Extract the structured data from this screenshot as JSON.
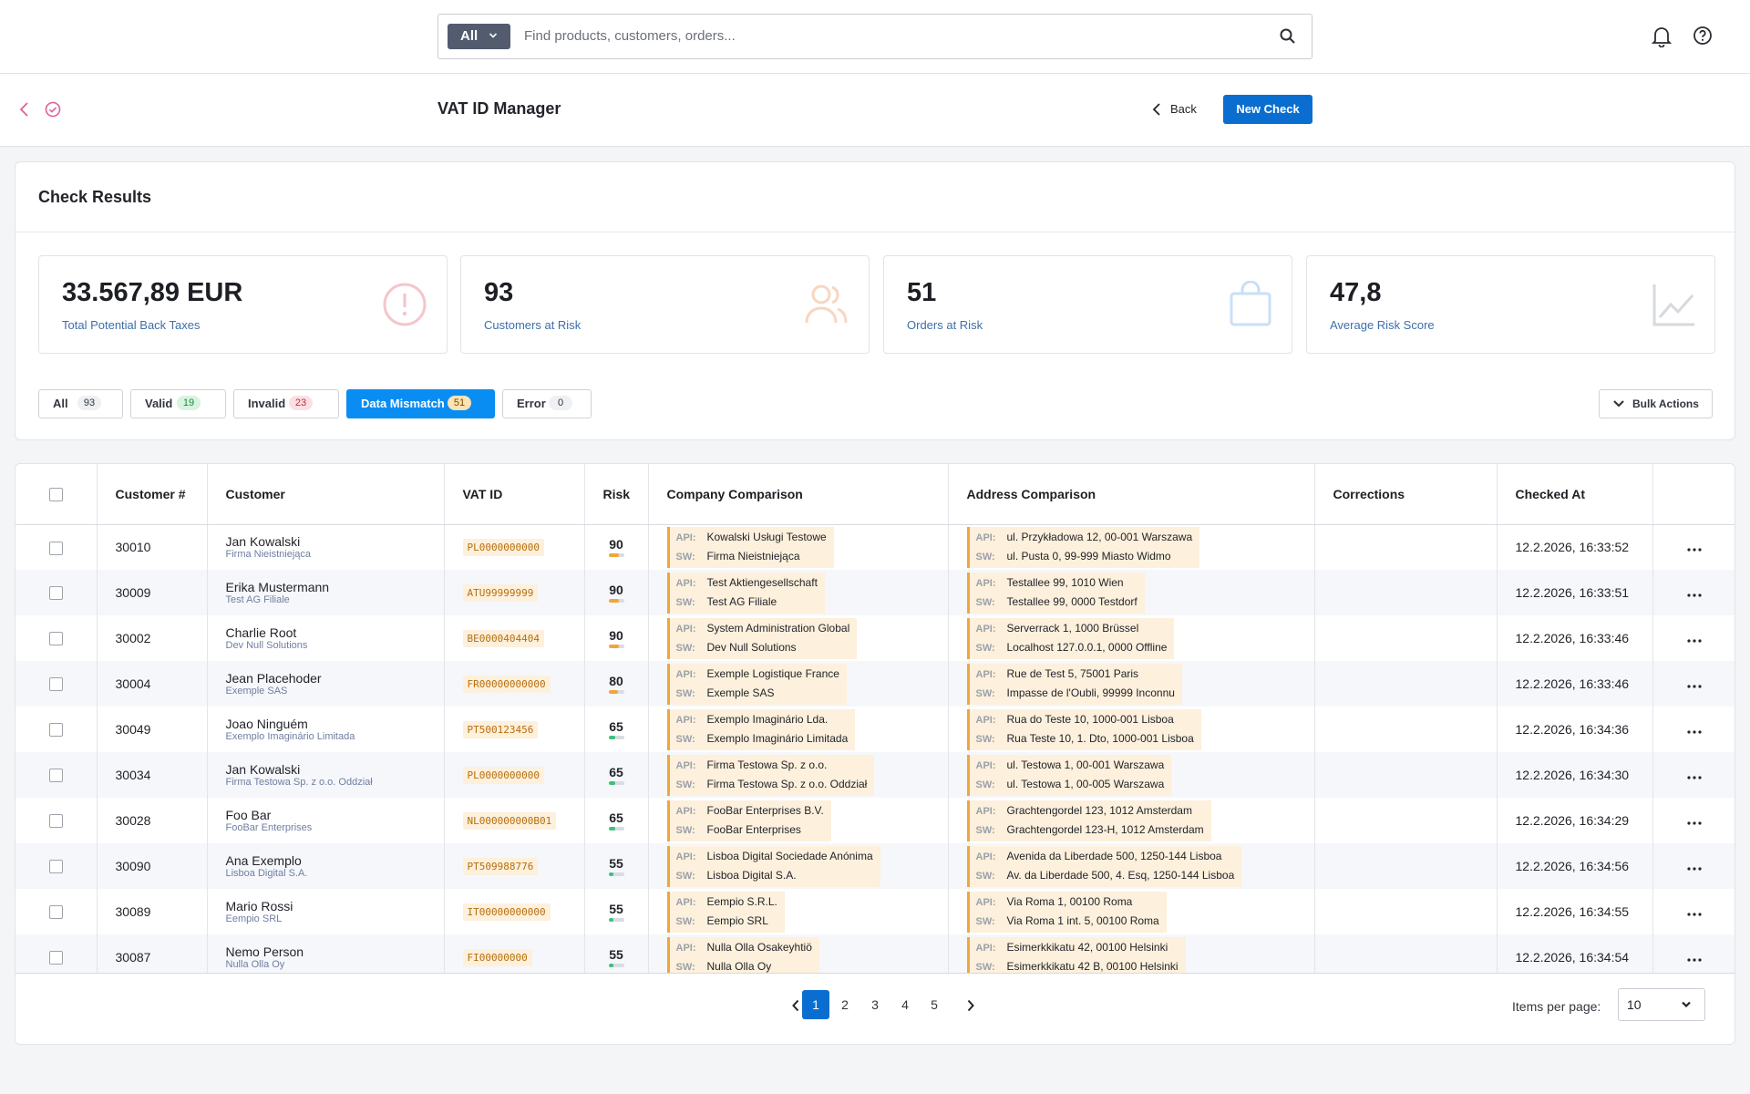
{
  "search": {
    "scope": "All",
    "placeholder": "Find products, customers, orders..."
  },
  "header": {
    "title": "VAT ID Manager",
    "back_label": "Back",
    "new_label": "New Check"
  },
  "card": {
    "title": "Check Results"
  },
  "kpis": [
    {
      "value": "33.567,89 EUR",
      "label": "Total Potential Back Taxes",
      "icon": "alert-circle-icon",
      "color": "#f3c6cc"
    },
    {
      "value": "93",
      "label": "Customers at Risk",
      "icon": "users-icon",
      "color": "#f7d6c2"
    },
    {
      "value": "51",
      "label": "Orders at Risk",
      "icon": "shopping-bag-icon",
      "color": "#c8dff6"
    },
    {
      "value": "47,8",
      "label": "Average Risk Score",
      "icon": "chart-line-icon",
      "color": "#d6d9de"
    }
  ],
  "filters": [
    {
      "label": "All",
      "count": "93",
      "active": false
    },
    {
      "label": "Valid",
      "count": "19",
      "active": false
    },
    {
      "label": "Invalid",
      "count": "23",
      "active": false
    },
    {
      "label": "Data Mismatch",
      "count": "51",
      "active": true
    },
    {
      "label": "Error",
      "count": "0",
      "active": false
    }
  ],
  "bulk_label": "Bulk Actions",
  "columns": [
    "Customer #",
    "Customer",
    "VAT ID",
    "Risk",
    "Company Comparison",
    "Address Comparison",
    "Corrections",
    "Checked At"
  ],
  "rows": [
    {
      "num": "30010",
      "name": "Jan Kowalski",
      "sub": "Firma Nieistniejąca",
      "vat": "PL0000000000",
      "risk": "90",
      "risk_pct": 0.7,
      "risk_color": "#f0a63b",
      "api_co": "Kowalski Usługi Testowe",
      "sw_co": "Firma Nieistniejąca",
      "api_addr": "ul. Przykładowa 12, 00-001 Warszawa",
      "sw_addr": "ul. Pusta 0, 99-999 Miasto Widmo",
      "corrections": "",
      "checked": "12.2.2026, 16:33:52"
    },
    {
      "num": "30009",
      "name": "Erika Mustermann",
      "sub": "Test AG Filiale",
      "vat": "ATU99999999",
      "risk": "90",
      "risk_pct": 0.7,
      "risk_color": "#f0a63b",
      "api_co": "Test Aktiengesellschaft",
      "sw_co": "Test AG Filiale",
      "api_addr": "Testallee 99, 1010 Wien",
      "sw_addr": "Testallee 99, 0000 Testdorf",
      "corrections": "",
      "checked": "12.2.2026, 16:33:51"
    },
    {
      "num": "30002",
      "name": "Charlie Root",
      "sub": "Dev Null Solutions",
      "vat": "BE0000404404",
      "risk": "90",
      "risk_pct": 0.7,
      "risk_color": "#f0a63b",
      "api_co": "System Administration Global",
      "sw_co": "Dev Null Solutions",
      "api_addr": "Serverrack 1, 1000 Brüssel",
      "sw_addr": "Localhost 127.0.0.1, 0000 Offline",
      "corrections": "",
      "checked": "12.2.2026, 16:33:46"
    },
    {
      "num": "30004",
      "name": "Jean Placehoder",
      "sub": "Exemple SAS",
      "vat": "FR00000000000",
      "risk": "80",
      "risk_pct": 0.6,
      "risk_color": "#f0a63b",
      "api_co": "Exemple Logistique France",
      "sw_co": "Exemple SAS",
      "api_addr": "Rue de Test 5, 75001 Paris",
      "sw_addr": "Impasse de l'Oubli, 99999 Inconnu",
      "corrections": "",
      "checked": "12.2.2026, 16:33:46"
    },
    {
      "num": "30049",
      "name": "Joao Ninguém",
      "sub": "Exemplo Imaginário Limitada",
      "vat": "PT500123456",
      "risk": "65",
      "risk_pct": 0.45,
      "risk_color": "#3cc17a",
      "api_co": "Exemplo Imaginário Lda.",
      "sw_co": "Exemplo Imaginário Limitada",
      "api_addr": "Rua do Teste 10, 1000-001 Lisboa",
      "sw_addr": "Rua Teste 10, 1. Dto, 1000-001 Lisboa",
      "corrections": "",
      "checked": "12.2.2026, 16:34:36"
    },
    {
      "num": "30034",
      "name": "Jan Kowalski",
      "sub": "Firma Testowa Sp. z o.o. Oddział",
      "vat": "PL0000000000",
      "risk": "65",
      "risk_pct": 0.45,
      "risk_color": "#3cc17a",
      "api_co": "Firma Testowa Sp. z o.o.",
      "sw_co": "Firma Testowa Sp. z o.o. Oddział",
      "api_addr": "ul. Testowa 1, 00-001 Warszawa",
      "sw_addr": "ul. Testowa 1, 00-005 Warszawa",
      "corrections": "",
      "checked": "12.2.2026, 16:34:30"
    },
    {
      "num": "30028",
      "name": "Foo Bar",
      "sub": "FooBar Enterprises",
      "vat": "NL000000000B01",
      "risk": "65",
      "risk_pct": 0.45,
      "risk_color": "#3cc17a",
      "api_co": "FooBar Enterprises B.V.",
      "sw_co": "FooBar Enterprises",
      "api_addr": "Grachtengordel 123, 1012 Amsterdam",
      "sw_addr": "Grachtengordel 123-H, 1012 Amsterdam",
      "corrections": "",
      "checked": "12.2.2026, 16:34:29"
    },
    {
      "num": "30090",
      "name": "Ana Exemplo",
      "sub": "Lisboa Digital S.A.",
      "vat": "PT509988776",
      "risk": "55",
      "risk_pct": 0.35,
      "risk_color": "#3cc17a",
      "api_co": "Lisboa Digital Sociedade Anónima",
      "sw_co": "Lisboa Digital S.A.",
      "api_addr": "Avenida da Liberdade 500, 1250-144 Lisboa",
      "sw_addr": "Av. da Liberdade 500, 4. Esq, 1250-144 Lisboa",
      "corrections": "",
      "checked": "12.2.2026, 16:34:56"
    },
    {
      "num": "30089",
      "name": "Mario Rossi",
      "sub": "Eempio SRL",
      "vat": "IT00000000000",
      "risk": "55",
      "risk_pct": 0.35,
      "risk_color": "#3cc17a",
      "api_co": "Eempio S.R.L.",
      "sw_co": "Eempio SRL",
      "api_addr": "Via Roma 1, 00100 Roma",
      "sw_addr": "Via Roma 1 int. 5, 00100 Roma",
      "corrections": "",
      "checked": "12.2.2026, 16:34:55"
    },
    {
      "num": "30087",
      "name": "Nemo Person",
      "sub": "Nulla Olla Oy",
      "vat": "FI00000000",
      "risk": "55",
      "risk_pct": 0.35,
      "risk_color": "#3cc17a",
      "api_co": "Nulla Olla Osakeyhtiö",
      "sw_co": "Nulla Olla Oy",
      "api_addr": "Esimerkkikatu 42, 00100 Helsinki",
      "sw_addr": "Esimerkkikatu 42 B, 00100 Helsinki",
      "corrections": "",
      "checked": "12.2.2026, 16:34:54"
    }
  ],
  "labels": {
    "api": "API:",
    "sw": "SW:"
  },
  "pagination": {
    "pages": [
      "1",
      "2",
      "3",
      "4",
      "5"
    ],
    "current": "1",
    "items_per_page_label": "Items per page:",
    "items_per_page": "10"
  }
}
